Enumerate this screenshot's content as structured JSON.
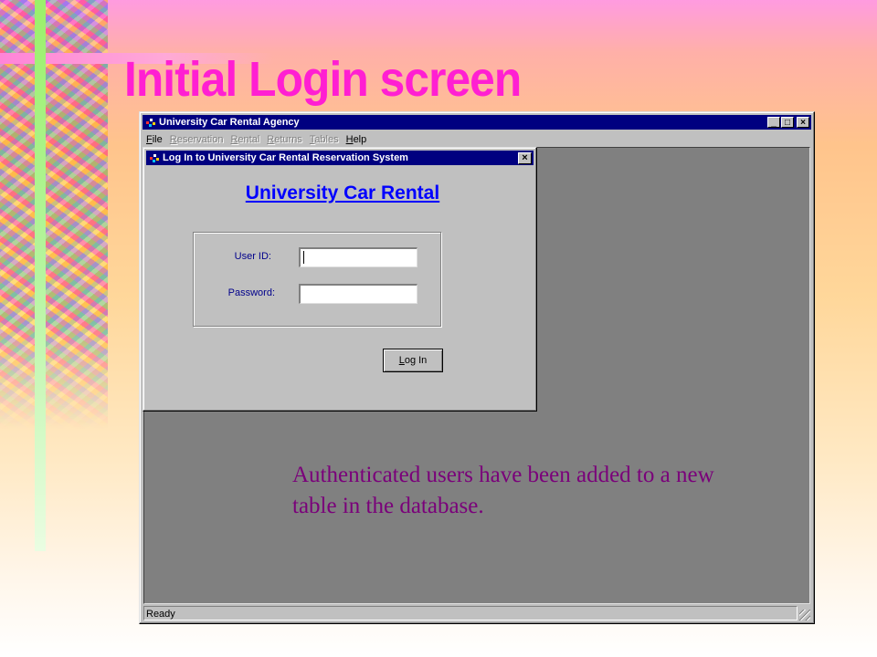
{
  "slide": {
    "title": "Initial Login screen",
    "annotation": "Authenticated users have been added to a new table in the database.",
    "title_color": "#ff1fd2",
    "annotation_color": "#7a007a"
  },
  "app_window": {
    "title": "University Car Rental Agency",
    "icon": "car-rental-app-icon",
    "buttons": {
      "minimize": "_",
      "maximize": "□",
      "close": "×"
    },
    "menu": [
      {
        "label_u": "F",
        "label_rest": "ile",
        "enabled": true
      },
      {
        "label_u": "R",
        "label_rest": "eservation",
        "enabled": false
      },
      {
        "label_u": "R",
        "label_rest": "ental",
        "enabled": false
      },
      {
        "label_u": "R",
        "label_rest": "eturns",
        "enabled": false
      },
      {
        "label_u": "T",
        "label_rest": "ables",
        "enabled": false
      },
      {
        "label_u": "H",
        "label_rest": "elp",
        "enabled": true
      }
    ],
    "status_text": "Ready",
    "title_bar_color": "#000080",
    "client_color": "#808080"
  },
  "login_dialog": {
    "title": "Log In to University Car Rental Reservation System",
    "close": "×",
    "heading": "University Car Rental",
    "user_id_label": "User ID:",
    "user_id_value": "",
    "password_label": "Password:",
    "password_value": "",
    "button_u": "L",
    "button_rest": "og In",
    "heading_color": "#0000ff"
  }
}
